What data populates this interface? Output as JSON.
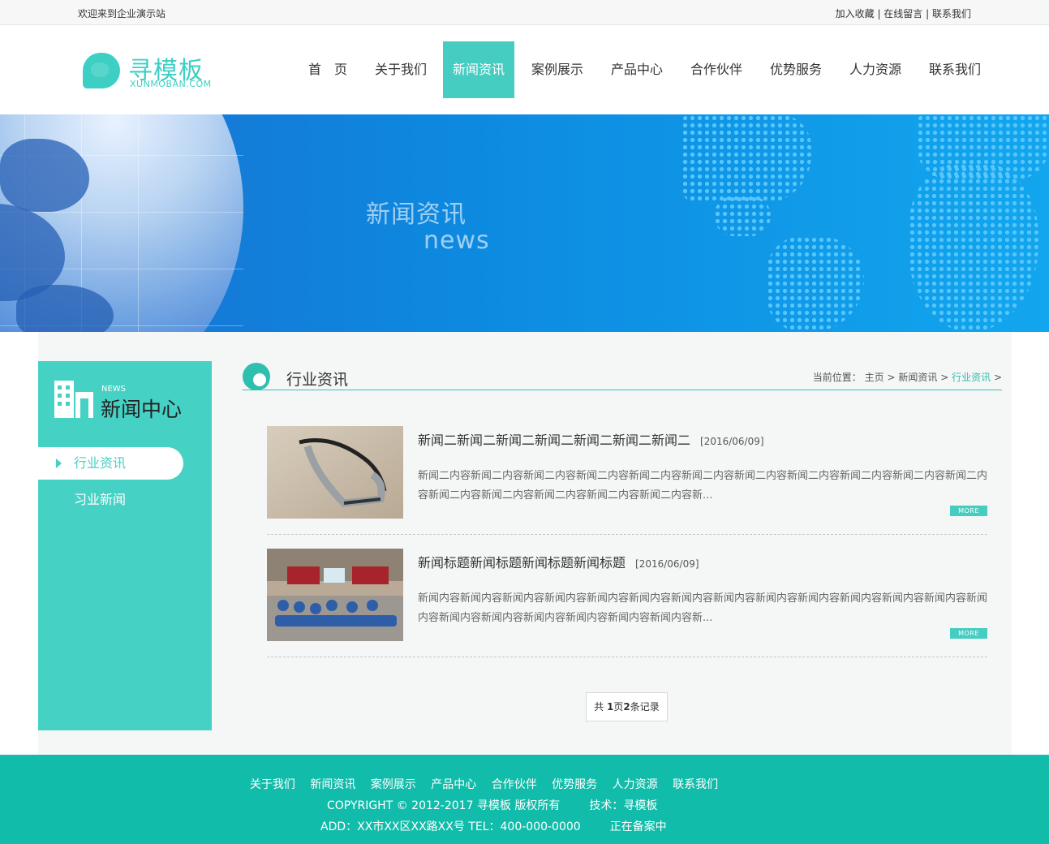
{
  "topbar": {
    "welcome": "欢迎来到企业演示站",
    "links": [
      "加入收藏",
      "在线留言",
      "联系我们"
    ],
    "separator": " | "
  },
  "logo": {
    "name": "寻模板",
    "sub": "XUNMOBAN.COM"
  },
  "nav": {
    "items": [
      "首　页",
      "关于我们",
      "新闻资讯",
      "案例展示",
      "产品中心",
      "合作伙伴",
      "优势服务",
      "人力资源",
      "联系我们"
    ],
    "active_index": 2
  },
  "banner": {
    "title": "新闻资讯",
    "subtitle": "news"
  },
  "sidebar": {
    "en": "NEWS",
    "title": "新闻中心",
    "items": [
      "行业资讯",
      "习业新闻"
    ],
    "active_index": 0
  },
  "content": {
    "section_title": "行业资讯",
    "breadcrumb": {
      "label": "当前位置：",
      "home": "主页",
      "parent": "新闻资讯",
      "current": "行业资讯",
      "sep": ">"
    },
    "news": [
      {
        "title": "新闻二新闻二新闻二新闻二新闻二新闻二新闻二",
        "date": "[2016/06/09]",
        "desc": "新闻二内容新闻二内容新闻二内容新闻二内容新闻二内容新闻二内容新闻二内容新闻二内容新闻二内容新闻二内容新闻二内容新闻二内容新闻二内容新闻二内容新闻二内容新闻二内容新...",
        "more": "MORE"
      },
      {
        "title": "新闻标题新闻标题新闻标题新闻标题",
        "date": "[2016/06/09]",
        "desc": "新闻内容新闻内容新闻内容新闻内容新闻内容新闻内容新闻内容新闻内容新闻内容新闻内容新闻内容新闻内容新闻内容新闻内容新闻内容新闻内容新闻内容新闻内容新闻内容新闻内容新...",
        "more": "MORE"
      }
    ],
    "pager": {
      "pre": "共 ",
      "page": "1",
      "mid": "页",
      "count": "2",
      "post": "条记录"
    }
  },
  "footer": {
    "nav": [
      "关于我们",
      "新闻资讯",
      "案例展示",
      "产品中心",
      "合作伙伴",
      "优势服务",
      "人力资源",
      "联系我们"
    ],
    "copyright": "COPYRIGHT © 2012-2017 寻模板 版权所有",
    "tech": "技术：寻模板",
    "address": "ADD：XX市XX区XX路XX号  TEL：400-000-0000",
    "icp": "正在备案中"
  },
  "colors": {
    "accent": "#45cdc1",
    "footer": "#12bcaa",
    "banner": "#0d8ae0"
  }
}
